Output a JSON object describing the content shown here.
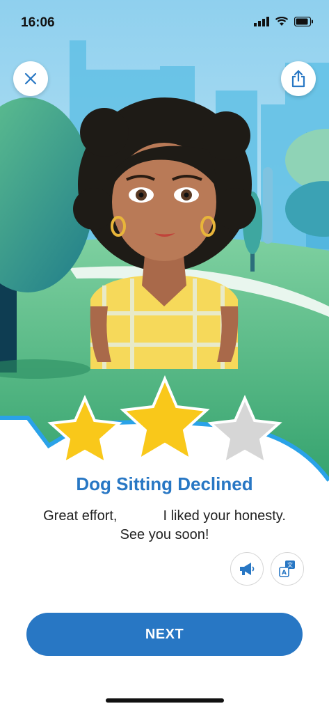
{
  "status_bar": {
    "time": "16:06"
  },
  "result": {
    "title": "Dog Sitting Declined",
    "stars_earned": 2,
    "stars_total": 3,
    "message_line1_start": "Great effort,",
    "message_line1_end": "I liked your honesty.",
    "message_line2": "See you soon!"
  },
  "buttons": {
    "next_label": "NEXT"
  },
  "icons": {
    "close": "close-icon",
    "share": "share-icon",
    "audio": "megaphone-icon",
    "translate": "translate-icon"
  },
  "colors": {
    "accent": "#2877c4",
    "star_gold": "#f9c81a",
    "star_gray": "#d6d6d6",
    "sky": "#9fd8f2",
    "grass": "#4db87a"
  }
}
